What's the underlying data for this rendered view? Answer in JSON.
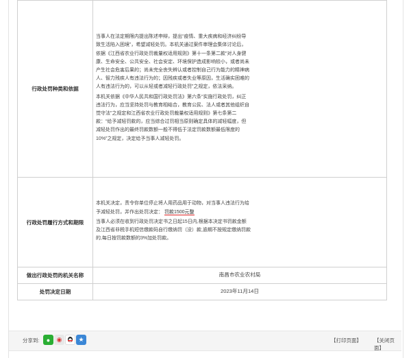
{
  "rows": {
    "penalty_type": {
      "label": "行政处罚种类和依据",
      "paragraph1": "当事人在法定期限内提出陈述申辩，提出“疫情、重大疾病和经济纠纷导致生活陷入困境”，希望减轻处罚。本机关通过案件审理会集体讨论后，依据《江西省农业行政处罚裁量权适用规则》第十一条第二款“对人身健康、生命安全、公共安全、社会安定、环境保护造成影响较小，或者尚未产生社会危害后果的；尚未完全丧失辨认或者控制自己行为能力的精神病人、智力残疾人有违法行为的；因残疾或者失业等原因，生活确实困难的人有违法行为的，可以从轻或者减轻行政处罚”之规定，依法采纳。",
      "paragraph2": "本机关依据《中华人民共和国行政处罚法》第六条“实施行政处罚，纠正违法行为，应当坚持处罚与教育相结合，教育公民、法人或者其他组织自觉守法”之规定和江西省农业行政处罚裁量权适用规则》第七条第二款：“给予减轻罚款的，应当综合过罚相当原则确定具体的减轻幅度，但减轻处罚作出的最终罚款数额一般不得低于法定罚款数额最低限度的10%”之规定，决定给予当事人减轻处罚。"
    },
    "execution": {
      "label": "行政处罚履行方式和期限",
      "text_before": "本机关决定，责令你单位停止将人用药品用于动物，对当事人违法行为给予减轻处罚，并作出处罚决定：",
      "fine_highlight": "罚款1500元整",
      "paragraph2": "当事人必须在收到行政处罚决定书之日起15日内,根据本决定书罚款金额及江西省非税手机短信缴款码自行缴纳罚（没）款,逾期不按规定缴纳罚款的,每日按罚款数额的3%加处罚款。"
    },
    "authority": {
      "label": "做出行政处罚的机关名称",
      "value": "南昌市农业农村局"
    },
    "decision_date": {
      "label": "处罚决定日期",
      "value": "2023年11月14日"
    }
  },
  "footer": {
    "share_label": "分享到:",
    "icons": [
      "wechat-icon",
      "weibo-icon",
      "qq-icon",
      "qzone-icon"
    ],
    "print_button": "【打印页面】",
    "close_button": "【关闭页面】"
  }
}
